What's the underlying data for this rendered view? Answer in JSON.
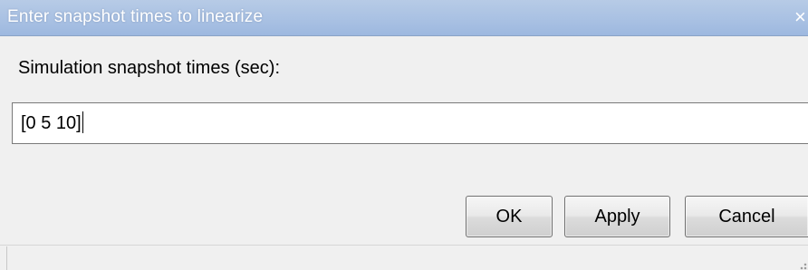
{
  "window": {
    "title": "Enter snapshot times to linearize",
    "close_glyph": "×"
  },
  "form": {
    "label": "Simulation snapshot times (sec):",
    "snapshot_times": {
      "value": "[0 5 10]"
    }
  },
  "buttons": {
    "ok_label": "OK",
    "apply_label": "Apply",
    "cancel_label": "Cancel"
  },
  "icons": {
    "close": "close-icon",
    "resize": "resize-grip-icon"
  },
  "colors": {
    "title_bar": "#a9c1e3",
    "title_text": "#ffffff",
    "dialog_background": "#f0f0f0",
    "input_background": "#ffffff",
    "button_border": "#707070"
  }
}
